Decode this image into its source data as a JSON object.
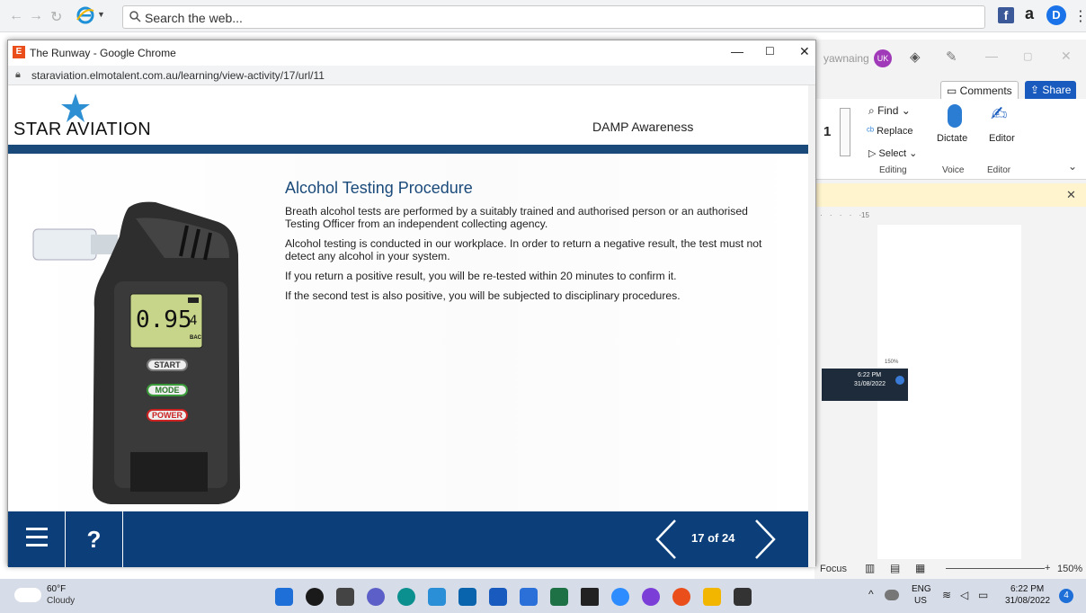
{
  "browser": {
    "search_placeholder": "Search the web...",
    "right_icons": [
      "facebook-icon",
      "amazon-icon",
      "extension-icon",
      "menu-icon"
    ]
  },
  "popup": {
    "title": "The Runway - Google Chrome",
    "url": "staraviation.elmotalent.com.au/learning/view-activity/17/url/11",
    "brand": "STAR AVIATION",
    "module": "DAMP Awareness",
    "heading": "Alcohol Testing Procedure",
    "paragraphs": [
      "Breath alcohol tests are performed by a suitably trained and authorised person or an authorised Testing Officer from an independent collecting agency.",
      "Alcohol testing is conducted in our workplace. In order to return a negative result, the test must not detect any alcohol in your system.",
      "If you return a positive result, you will be re-tested within 20 minutes to confirm it.",
      "If the second test is also positive, you will be subjected to disciplinary procedures."
    ],
    "device": {
      "reading": "0.95",
      "reading_suffix": "4",
      "unit": "BAC",
      "start": "START",
      "mode": "MODE",
      "power": "POWER"
    },
    "footer": {
      "help": "?",
      "page": "17 of 24"
    }
  },
  "word": {
    "user_name": "yawnaing",
    "avatar": "UK",
    "comments": "Comments",
    "share": "Share",
    "find": "Find",
    "replace": "Replace",
    "select": "Select",
    "dictate": "Dictate",
    "editor": "Editor",
    "group_editing": "Editing",
    "group_voice": "Voice",
    "group_editor": "Editor",
    "ruler_mark": "15",
    "font_size_digit": "1",
    "status_focus": "Focus",
    "zoom": "150%",
    "mini_zoom": "150%",
    "mini_time": "6:22 PM",
    "mini_date": "31/08/2022"
  },
  "taskbar": {
    "weather_temp": "60°F",
    "weather_desc": "Cloudy",
    "lang_top": "ENG",
    "lang_bottom": "US",
    "time": "6:22 PM",
    "date": "31/08/2022",
    "notif_count": "4"
  },
  "colors": {
    "brand_blue": "#0c3f7a",
    "accent_red": "#e94e1b"
  }
}
